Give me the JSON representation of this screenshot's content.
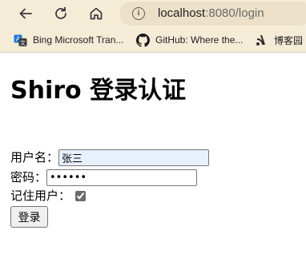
{
  "browser": {
    "url_host": "localhost",
    "url_rest": ":8080/login",
    "bookmarks": [
      {
        "label": "Bing Microsoft Tran...",
        "icon": "bing-translator-icon"
      },
      {
        "label": "GitHub: Where the...",
        "icon": "github-icon"
      },
      {
        "label": "博客园",
        "icon": "cnblogs-icon"
      }
    ]
  },
  "page": {
    "title": "Shiro 登录认证",
    "form": {
      "username_label": "用户名：",
      "username_value": "张三",
      "password_label": "密码：",
      "password_value": "123456",
      "remember_label": "记住用户：",
      "remember_checked": true,
      "submit_label": "登录"
    }
  }
}
